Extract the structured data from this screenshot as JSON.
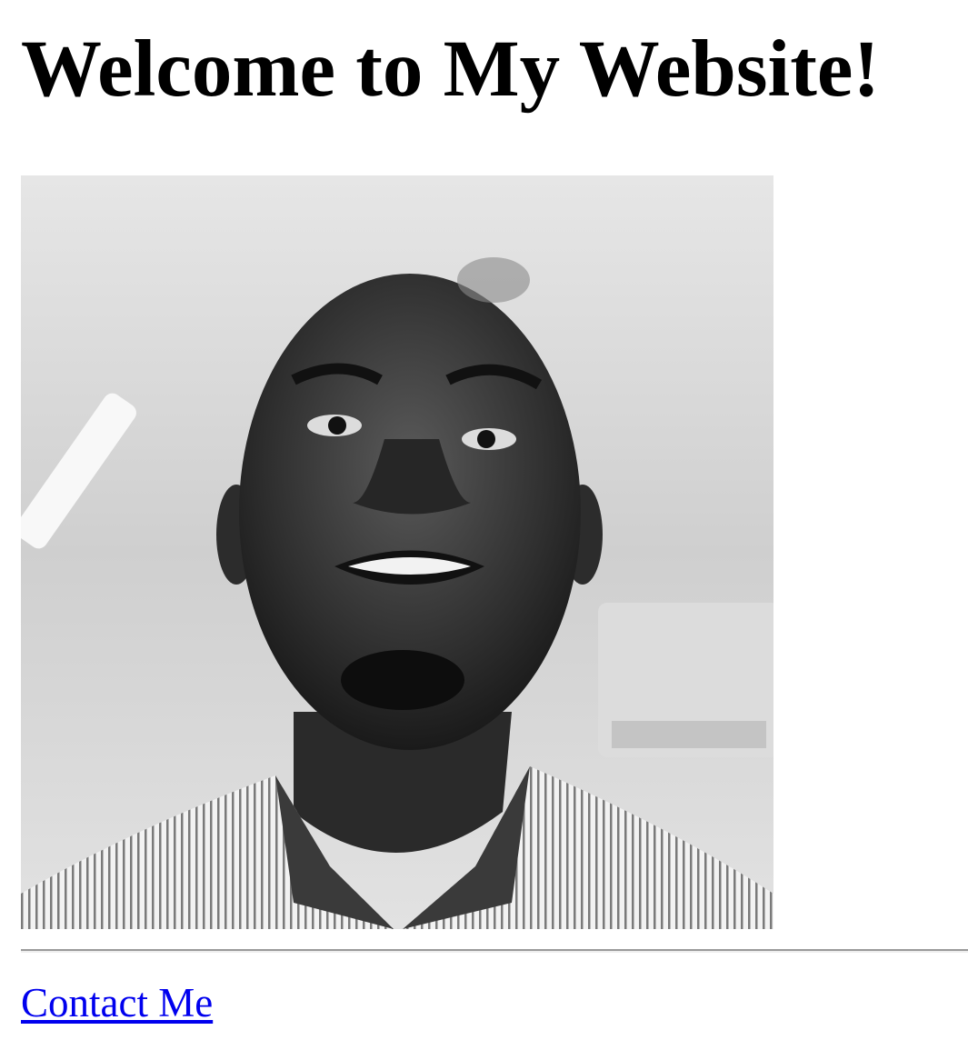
{
  "header": {
    "title": "Welcome to My Website!"
  },
  "profile_photo": {
    "icon": "portrait-photo",
    "alt": "Profile photo"
  },
  "footer": {
    "contact_label": "Contact Me"
  },
  "colors": {
    "link": "#0000ee",
    "text": "#000000",
    "divider": "#9a9a9a",
    "background": "#ffffff"
  }
}
